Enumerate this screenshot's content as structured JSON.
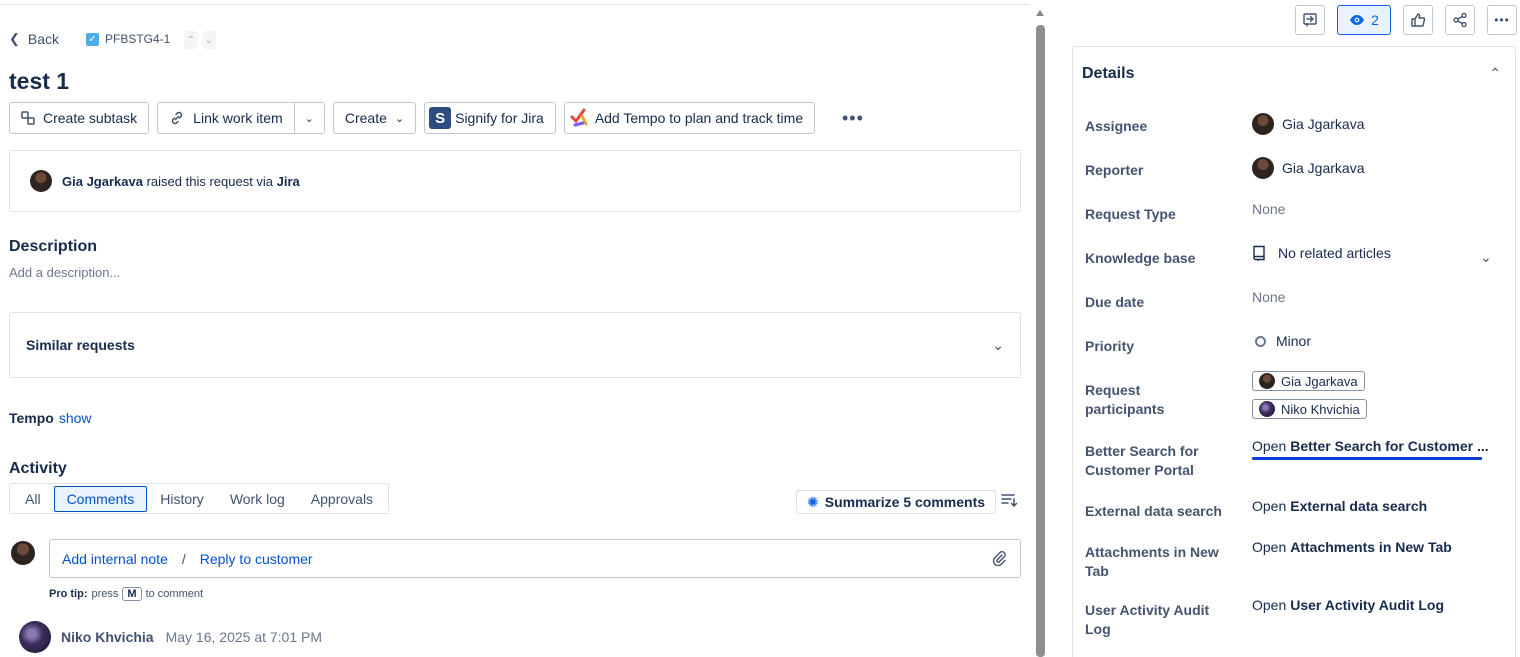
{
  "nav": {
    "back_label": "Back",
    "issue_key": "PFBSTG4-1"
  },
  "issue": {
    "title": "test 1"
  },
  "toolbar": {
    "create_subtask": "Create subtask",
    "link_work_item": "Link work item",
    "create": "Create",
    "signify": "Signify for Jira",
    "tempo": "Add Tempo to plan and track time"
  },
  "request": {
    "reporter": "Gia Jgarkava",
    "raised_text": "raised this request via",
    "channel": "Jira"
  },
  "description": {
    "heading": "Description",
    "placeholder": "Add a description..."
  },
  "similar": {
    "label": "Similar requests"
  },
  "tempo_section": {
    "label": "Tempo",
    "link": "show"
  },
  "activity": {
    "heading": "Activity",
    "tabs": [
      "All",
      "Comments",
      "History",
      "Work log",
      "Approvals"
    ],
    "active_tab": "Comments",
    "summarize": "Summarize 5 comments",
    "comment_box": {
      "internal_note": "Add internal note",
      "separator": "/",
      "reply": "Reply to customer"
    },
    "protip": {
      "label": "Pro tip:",
      "press": "press",
      "key": "M",
      "suffix": "to comment"
    },
    "latest_comment": {
      "author": "Niko Khvichia",
      "date": "May 16, 2025 at 7:01 PM"
    }
  },
  "header_actions": {
    "watch_count": "2"
  },
  "details": {
    "heading": "Details",
    "fields": {
      "assignee": {
        "label": "Assignee",
        "value": "Gia Jgarkava"
      },
      "reporter": {
        "label": "Reporter",
        "value": "Gia Jgarkava"
      },
      "request_type": {
        "label": "Request Type",
        "value": "None"
      },
      "knowledge_base": {
        "label": "Knowledge base",
        "value": "No related articles"
      },
      "due_date": {
        "label": "Due date",
        "value": "None"
      },
      "priority": {
        "label": "Priority",
        "value": "Minor"
      },
      "participants": {
        "label": "Request participants",
        "values": [
          "Gia Jgarkava",
          "Niko Khvichia"
        ]
      },
      "better_search": {
        "label": "Better Search for Customer Portal",
        "open": "Open",
        "value": "Better Search for Customer ..."
      },
      "external_search": {
        "label": "External data search",
        "open": "Open",
        "value": "External data search"
      },
      "attachments": {
        "label": "Attachments in New Tab",
        "open": "Open",
        "value": "Attachments in New Tab"
      },
      "audit_log": {
        "label": "User Activity Audit Log",
        "open": "Open",
        "value": "User Activity Audit Log"
      }
    }
  },
  "colors": {
    "accent": "#0052cc",
    "text": "#172b4d",
    "subtle": "#6b778c",
    "border": "#dfe1e6",
    "selected_bg": "#e9f2ff"
  },
  "icons": [
    "chevron-left-icon",
    "checkbox-icon",
    "chevron-up-icon",
    "chevron-down-icon",
    "subtask-icon",
    "link-icon",
    "signify-icon",
    "tempo-icon",
    "more-icon",
    "sparkle-icon",
    "sort-icon",
    "paperclip-icon",
    "feedback-icon",
    "eye-icon",
    "thumbs-up-icon",
    "share-icon",
    "book-icon",
    "priority-minor-icon"
  ]
}
